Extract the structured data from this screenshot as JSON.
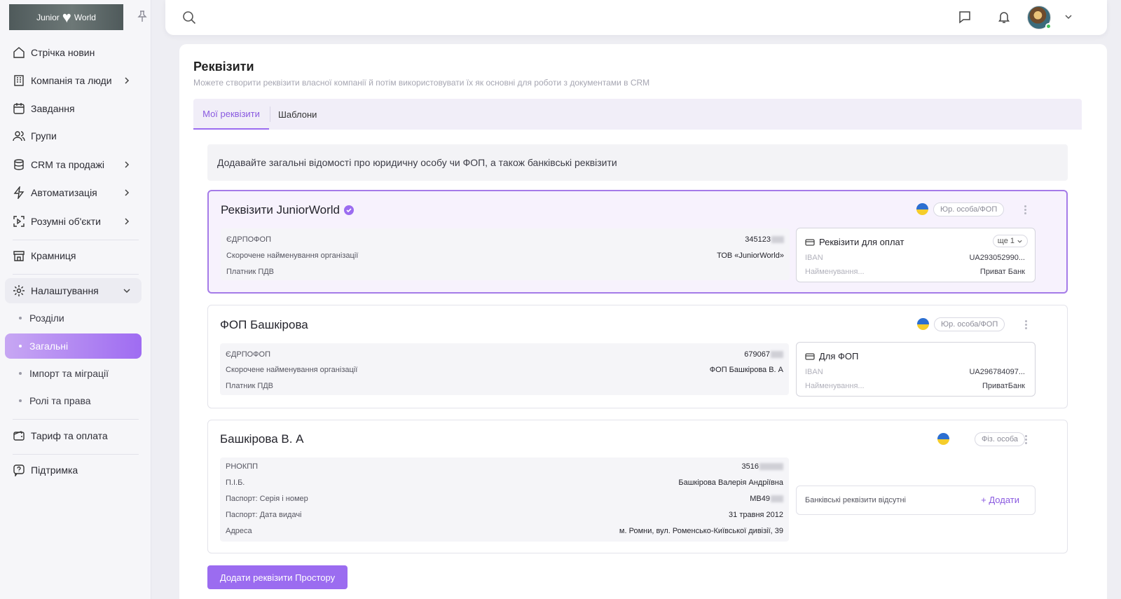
{
  "logo": {
    "text_left": "Junior",
    "text_right": "World"
  },
  "sidebar": {
    "items": [
      {
        "label": "Стрічка новин",
        "icon": "home-icon",
        "has_chevron": false
      },
      {
        "label": "Компанія та люди",
        "icon": "building-icon",
        "has_chevron": true
      },
      {
        "label": "Завдання",
        "icon": "calendar-icon",
        "has_chevron": false
      },
      {
        "label": "Групи",
        "icon": "users-icon",
        "has_chevron": false
      },
      {
        "label": "CRM та продажі",
        "icon": "database-icon",
        "has_chevron": true
      },
      {
        "label": "Автоматизація",
        "icon": "lightning-icon",
        "has_chevron": true
      },
      {
        "label": "Розумні об'єкти",
        "icon": "smart-object-icon",
        "has_chevron": true
      },
      {
        "label": "Крамниця",
        "icon": "store-icon",
        "has_chevron": false
      },
      {
        "label": "Налаштування",
        "icon": "gear-icon",
        "has_chevron": true,
        "expanded": true
      }
    ],
    "settings_sub": [
      {
        "label": "Розділи"
      },
      {
        "label": "Загальні",
        "active": true
      },
      {
        "label": "Імпорт та міграції"
      },
      {
        "label": "Ролі та права"
      }
    ],
    "bottom": [
      {
        "label": "Тариф та оплата",
        "icon": "wallet-icon"
      },
      {
        "label": "Підтримка",
        "icon": "help-icon"
      }
    ]
  },
  "page": {
    "title": "Реквізити",
    "subtitle": "Можете створити реквізити власної компанії й потім використовувати їх як основні для роботи з документами в CRM",
    "tabs": [
      {
        "label": "Мої реквізити",
        "active": true
      },
      {
        "label": "Шаблони"
      }
    ],
    "hint": "Додавайте загальні відомості про юридичну особу чи ФОП, а також банківські реквізити",
    "add_button": "Додати реквізити Простору"
  },
  "cards": [
    {
      "title": "Реквізити JuniorWorld",
      "verified": true,
      "type_label": "Юр. особа/ФОП",
      "fields": [
        {
          "k": "ЄДРПОФОП",
          "v": "345123"
        },
        {
          "k": "Скорочене найменування організації",
          "v": "ТОВ «JuniorWorld»"
        },
        {
          "k": "Платник ПДВ",
          "v": ""
        }
      ],
      "bank": {
        "title": "Реквізити для оплат",
        "more": "ще 1",
        "iban_label": "IBAN",
        "iban_value": "UA293052990...",
        "name_label": "Найменування...",
        "name_value": "Приват Банк"
      }
    },
    {
      "title": "ФОП Башкірова",
      "verified": false,
      "type_label": "Юр. особа/ФОП",
      "fields": [
        {
          "k": "ЄДРПОФОП",
          "v": "679067"
        },
        {
          "k": "Скорочене найменування організації",
          "v": "ФОП Башкірова В. А"
        },
        {
          "k": "Платник ПДВ",
          "v": ""
        }
      ],
      "bank": {
        "title": "Для ФОП",
        "iban_label": "IBAN",
        "iban_value": "UA296784097...",
        "name_label": "Найменування...",
        "name_value": "ПриватБанк"
      }
    },
    {
      "title": "Башкірова В. А",
      "verified": false,
      "type_label": "Фіз. особа",
      "fields": [
        {
          "k": "РНОКПП",
          "v": "3516"
        },
        {
          "k": "П.І.Б.",
          "v": "Башкірова Валерія Андріївна"
        },
        {
          "k": "Паспорт: Серія і номер",
          "v": "МВ49"
        },
        {
          "k": "Паспорт: Дата видачі",
          "v": "31 травня 2012"
        },
        {
          "k": "Адреса",
          "v": "м. Ромни, вул. Роменсько-Київської дивізії, 39"
        }
      ],
      "bank_empty": {
        "text": "Банківські реквізити відсутні",
        "add_label": "+ Додати"
      }
    }
  ],
  "colors": {
    "accent": "#9b6cf0",
    "active_gradient_start": "#c7a7f3",
    "flag_blue": "#2c6fd1",
    "flag_yellow": "#f5cd2b"
  }
}
